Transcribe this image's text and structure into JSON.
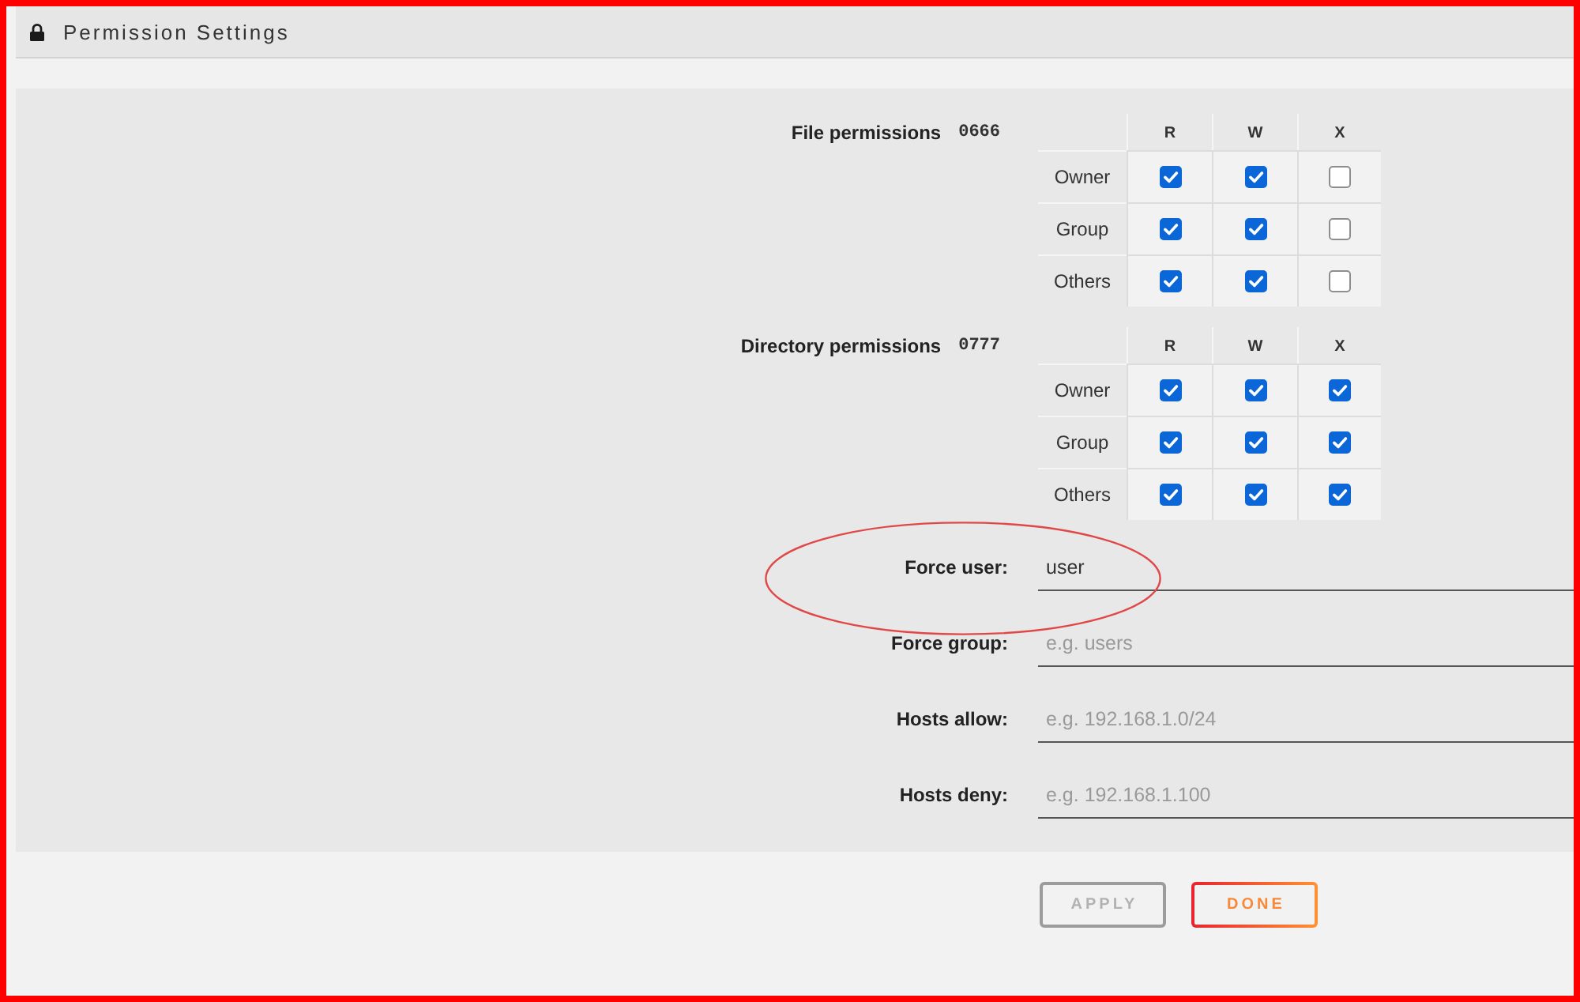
{
  "window": {
    "title": "Permission Settings"
  },
  "permissions": [
    {
      "label": "File permissions",
      "mode": "0666",
      "columns": [
        "R",
        "W",
        "X"
      ],
      "rows": [
        {
          "label": "Owner",
          "cells": [
            {
              "checked": true
            },
            {
              "checked": true
            },
            {
              "checked": false
            }
          ]
        },
        {
          "label": "Group",
          "cells": [
            {
              "checked": true
            },
            {
              "checked": true
            },
            {
              "checked": false
            }
          ]
        },
        {
          "label": "Others",
          "cells": [
            {
              "checked": true
            },
            {
              "checked": true
            },
            {
              "checked": false
            }
          ]
        }
      ]
    },
    {
      "label": "Directory permissions",
      "mode": "0777",
      "columns": [
        "R",
        "W",
        "X"
      ],
      "rows": [
        {
          "label": "Owner",
          "cells": [
            {
              "checked": true
            },
            {
              "checked": true
            },
            {
              "checked": true
            }
          ]
        },
        {
          "label": "Group",
          "cells": [
            {
              "checked": true
            },
            {
              "checked": true
            },
            {
              "checked": true
            }
          ]
        },
        {
          "label": "Others",
          "cells": [
            {
              "checked": true
            },
            {
              "checked": true
            },
            {
              "checked": true
            }
          ]
        }
      ]
    }
  ],
  "fields": [
    {
      "label": "Force user:",
      "value": "user",
      "highlighted": true
    },
    {
      "label": "Force group:",
      "placeholder": "e.g. users",
      "highlighted": false
    },
    {
      "label": "Hosts allow:",
      "placeholder": "e.g. 192.168.1.0/24",
      "highlighted": false
    },
    {
      "label": "Hosts deny:",
      "placeholder": "e.g. 192.168.1.100",
      "highlighted": false
    }
  ],
  "buttons": [
    {
      "label": "APPLY",
      "disabled": true
    },
    {
      "label": "DONE",
      "disabled": false
    }
  ]
}
